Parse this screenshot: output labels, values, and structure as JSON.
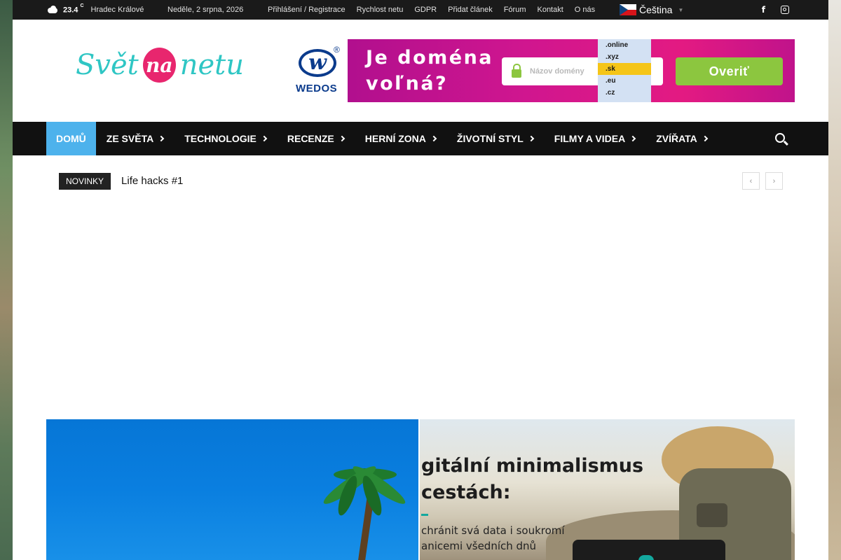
{
  "topbar": {
    "temperature": "23.4",
    "temperature_unit": "C",
    "city": "Hradec Králové",
    "date": "Neděle, 2 srpna, 2026",
    "menu": [
      "Přihlášení / Registrace",
      "Rychlost netu",
      "GDPR",
      "Přidat článek",
      "Fórum",
      "Kontakt",
      "O nás"
    ],
    "language": "Čeština",
    "icons": [
      "cloud-icon",
      "flag-cz-icon",
      "facebook-icon",
      "instagram-icon"
    ]
  },
  "logo": {
    "part1": "Svět",
    "part2": "na",
    "part3": "netu"
  },
  "ad": {
    "brand": "WEDOS",
    "brand_mark": "w",
    "registered": "®",
    "headline_line1": "Je doména",
    "headline_line2": "voľná?",
    "field_placeholder": "Názov domény",
    "domains": [
      ".online",
      ".xyz",
      ".sk",
      ".eu",
      ".cz"
    ],
    "selected_domain": ".sk",
    "button": "Overiť"
  },
  "nav": {
    "items": [
      {
        "label": "DOMŮ",
        "active": true,
        "dropdown": false
      },
      {
        "label": "ZE SVĚTA",
        "active": false,
        "dropdown": true
      },
      {
        "label": "TECHNOLOGIE",
        "active": false,
        "dropdown": true
      },
      {
        "label": "RECENZE",
        "active": false,
        "dropdown": true
      },
      {
        "label": "HERNÍ ZONA",
        "active": false,
        "dropdown": true
      },
      {
        "label": "ŽIVOTNÍ STYL",
        "active": false,
        "dropdown": true
      },
      {
        "label": "FILMY A VIDEA",
        "active": false,
        "dropdown": true
      },
      {
        "label": "ZVÍŘATA",
        "active": false,
        "dropdown": true
      }
    ],
    "accent_color": "#4db2ec"
  },
  "ticker": {
    "tag": "NOVINKY",
    "title": "Life hacks #1",
    "prev": "‹",
    "next": "›"
  },
  "featured": {
    "second": {
      "title_line1": "gitální minimalismus",
      "title_line2": "cestách:",
      "sub_line1": "chránit svá data i soukromí",
      "sub_line2": "anicemi všedních dnů"
    }
  }
}
